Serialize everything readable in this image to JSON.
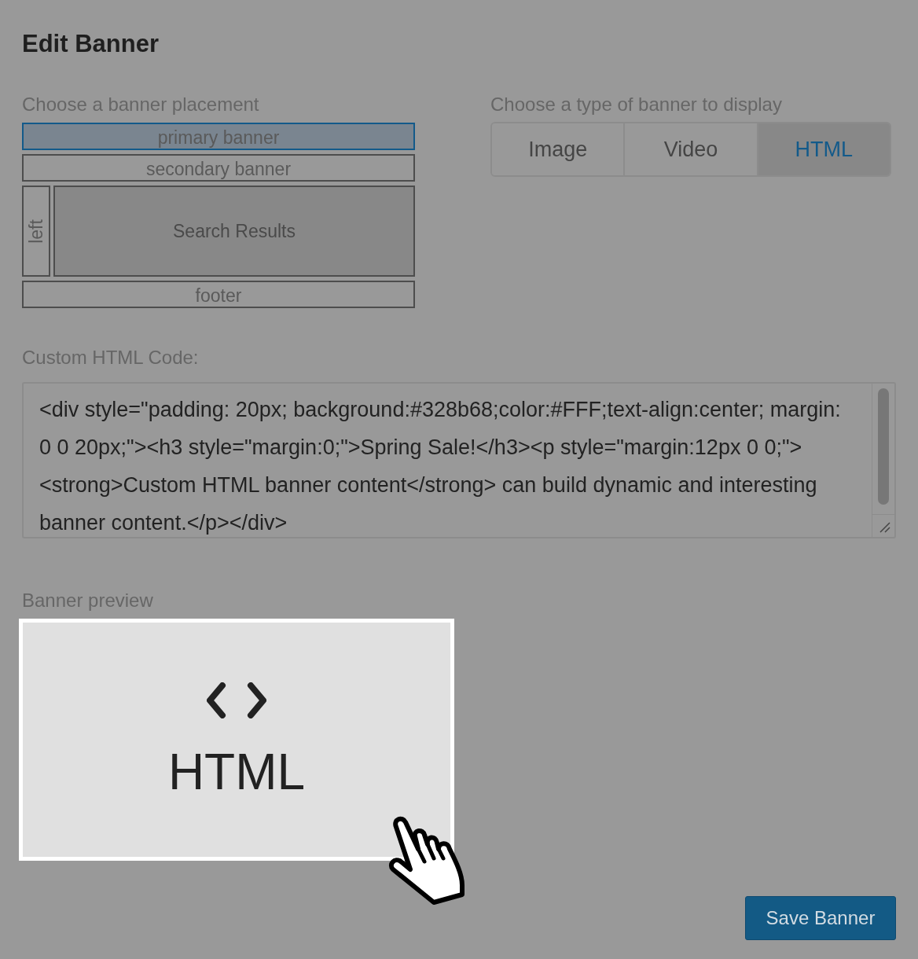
{
  "title": "Edit Banner",
  "placement": {
    "label": "Choose a banner placement",
    "items": [
      {
        "kind": "row",
        "label": "primary banner",
        "selected": true
      },
      {
        "kind": "row",
        "label": "secondary banner",
        "selected": false
      },
      {
        "kind": "side",
        "label": "left",
        "selected": false
      },
      {
        "kind": "content",
        "label": "Search Results",
        "selected": false
      },
      {
        "kind": "row",
        "label": "footer",
        "selected": false
      }
    ]
  },
  "banner_type": {
    "label": "Choose a type of banner to display",
    "tabs": [
      {
        "label": "Image",
        "selected": false
      },
      {
        "label": "Video",
        "selected": false
      },
      {
        "label": "HTML",
        "selected": true
      }
    ]
  },
  "custom_code": {
    "label": "Custom HTML Code:",
    "value": "<div style=\"padding: 20px; background:#328b68;color:#FFF;text-align:center; margin: 0 0 20px;\"><h3 style=\"margin:0;\">Spring Sale!</h3><p style=\"margin:12px 0 0;\"><strong>Custom HTML banner content</strong> can build dynamic and interesting banner content.</p></div>"
  },
  "preview": {
    "label": "Banner preview",
    "caption": "HTML"
  },
  "save_button": "Save Banner"
}
